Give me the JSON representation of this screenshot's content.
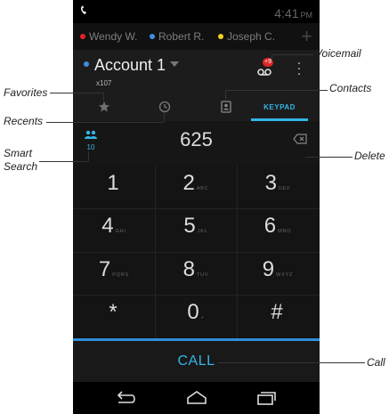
{
  "status": {
    "time": "4:41",
    "ampm": "PM"
  },
  "accounts_row": [
    {
      "name": "Wendy W.",
      "color": "#e8202a"
    },
    {
      "name": "Robert R.",
      "color": "#3d8fe0"
    },
    {
      "name": "Joseph C.",
      "color": "#f2d021"
    }
  ],
  "account": {
    "name": "Account 1",
    "ext": "x107",
    "color": "#3d8fe0"
  },
  "voicemail": {
    "badge": "+9"
  },
  "tabs": {
    "keypad_label": "KEYPAD"
  },
  "dialer": {
    "number": "625",
    "smart_count": "10"
  },
  "keys": [
    {
      "digit": "1",
      "letters": ""
    },
    {
      "digit": "2",
      "letters": "ABC"
    },
    {
      "digit": "3",
      "letters": "DEF"
    },
    {
      "digit": "4",
      "letters": "GHI"
    },
    {
      "digit": "5",
      "letters": "JKL"
    },
    {
      "digit": "6",
      "letters": "MNO"
    },
    {
      "digit": "7",
      "letters": "PQRS"
    },
    {
      "digit": "8",
      "letters": "TUV"
    },
    {
      "digit": "9",
      "letters": "WXYZ"
    },
    {
      "digit": "*",
      "letters": ""
    },
    {
      "digit": "0",
      "letters": "+"
    },
    {
      "digit": "#",
      "letters": ""
    }
  ],
  "call": {
    "label": "CALL"
  },
  "callouts": {
    "voicemail": "Voicemail",
    "contacts": "Contacts",
    "favorites": "Favorites",
    "recents": "Recents",
    "smart_search": [
      "Smart",
      "Search"
    ],
    "delete": "Delete",
    "call": "Call"
  },
  "colors": {
    "accent": "#33b5e5",
    "background": "#0c0c0c",
    "badge": "#e02424"
  }
}
